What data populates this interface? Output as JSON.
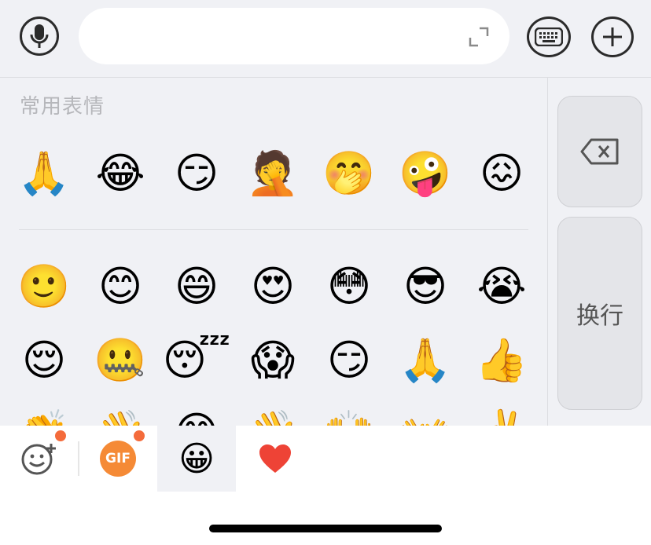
{
  "input_bar": {
    "text_value": "",
    "placeholder": ""
  },
  "panel": {
    "section_title": "常用表情",
    "frequent": [
      "🙏",
      "😂",
      "😏",
      "🤦",
      "🤭",
      "🤪",
      "😖"
    ],
    "grid_rows": [
      [
        "🙂",
        "😊",
        "😄",
        "😍",
        "😳",
        "😎",
        "😭"
      ],
      [
        "😌",
        "🤐",
        "😴",
        "😱",
        "😏",
        "🙏",
        "👍"
      ],
      [
        "👏",
        "👋",
        "😂",
        "👋",
        "🙌",
        "👐",
        "✌️"
      ]
    ],
    "enter_label": "换行"
  },
  "tabbar": {
    "gif_label": "GIF",
    "emoji_tab_glyph": "😀",
    "favorites_glyph": "❤️"
  },
  "colors": {
    "accent_badge": "#f46b3b",
    "gif_bg": "#f58a36",
    "panel_bg": "#f0f1f5"
  },
  "icons": [
    "microphone-icon",
    "expand-icon",
    "keyboard-icon",
    "plus-icon",
    "backspace-icon",
    "add-sticker-icon"
  ]
}
